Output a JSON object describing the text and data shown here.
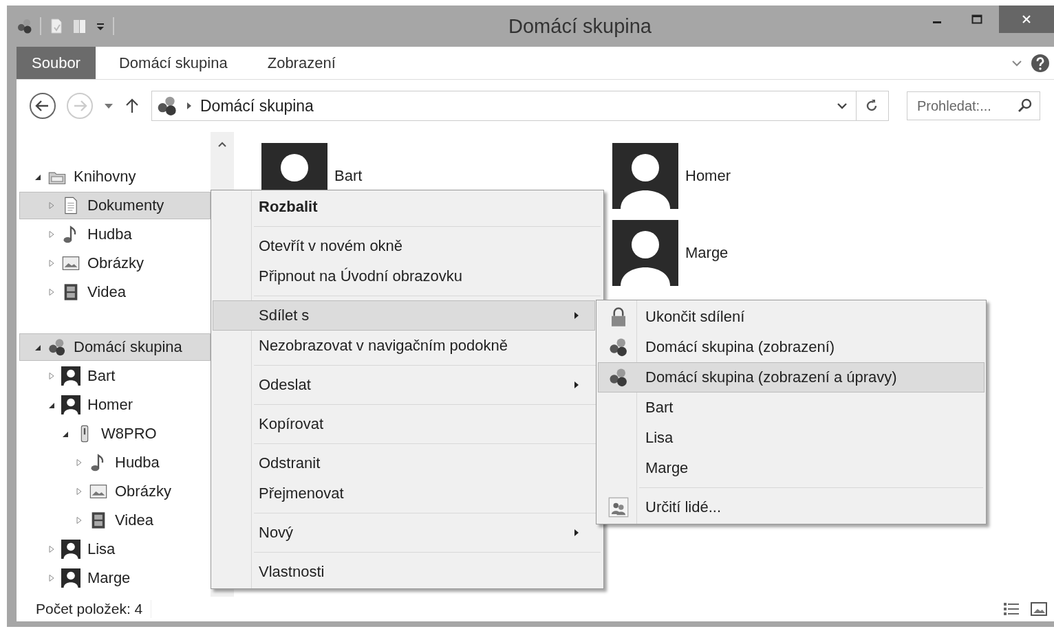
{
  "window": {
    "title": "Domácí skupina"
  },
  "ribbon": {
    "tabs": [
      {
        "label": "Soubor",
        "kind": "file",
        "selected": false
      },
      {
        "label": "Domácí skupina",
        "kind": "tab",
        "selected": false
      },
      {
        "label": "Zobrazení",
        "kind": "tab",
        "selected": false
      }
    ]
  },
  "address": {
    "path": "Domácí skupina",
    "search": {
      "placeholder": "Prohledat:..."
    }
  },
  "navigation": [
    {
      "label": "Knihovny",
      "kind": "library",
      "expanded": true,
      "selected": false,
      "children": [
        {
          "label": "Dokumenty",
          "kind": "document",
          "expanded": false,
          "selected": true
        },
        {
          "label": "Hudba",
          "kind": "music",
          "expanded": false,
          "selected": false
        },
        {
          "label": "Obrázky",
          "kind": "pictures",
          "expanded": false,
          "selected": false
        },
        {
          "label": "Videa",
          "kind": "video",
          "expanded": false,
          "selected": false
        }
      ]
    },
    {
      "label": "Domácí skupina",
      "kind": "homegroup",
      "expanded": true,
      "selected": true,
      "children": [
        {
          "label": "Bart",
          "kind": "user",
          "expanded": false,
          "selected": false
        },
        {
          "label": "Homer",
          "kind": "user",
          "expanded": true,
          "selected": false,
          "children": [
            {
              "label": "W8PRO",
              "kind": "drive",
              "expanded": true,
              "selected": false,
              "children": [
                {
                  "label": "Hudba",
                  "kind": "music",
                  "expanded": false,
                  "selected": false
                },
                {
                  "label": "Obrázky",
                  "kind": "pictures",
                  "expanded": false,
                  "selected": false
                },
                {
                  "label": "Videa",
                  "kind": "video",
                  "expanded": false,
                  "selected": false
                }
              ]
            }
          ]
        },
        {
          "label": "Lisa",
          "kind": "user",
          "expanded": false,
          "selected": false
        },
        {
          "label": "Marge",
          "kind": "user",
          "expanded": false,
          "selected": false
        }
      ]
    }
  ],
  "content": {
    "items": [
      {
        "name": "Bart"
      },
      {
        "name": "Homer"
      },
      {
        "name": "Marge"
      }
    ]
  },
  "context_menu": {
    "groups": [
      [
        {
          "label": "Rozbalit",
          "bold": true,
          "submenu": false,
          "selected": false
        }
      ],
      [
        {
          "label": "Otevřít v novém okně",
          "bold": false,
          "submenu": false,
          "selected": false
        },
        {
          "label": "Připnout na Úvodní obrazovku",
          "bold": false,
          "submenu": false,
          "selected": false
        }
      ],
      [
        {
          "label": "Sdílet s",
          "bold": false,
          "submenu": true,
          "selected": true
        },
        {
          "label": "Nezobrazovat v navigačním podokně",
          "bold": false,
          "submenu": false,
          "selected": false
        }
      ],
      [
        {
          "label": "Odeslat",
          "bold": false,
          "submenu": true,
          "selected": false
        }
      ],
      [
        {
          "label": "Kopírovat",
          "bold": false,
          "submenu": false,
          "selected": false
        }
      ],
      [
        {
          "label": "Odstranit",
          "bold": false,
          "submenu": false,
          "selected": false
        },
        {
          "label": "Přejmenovat",
          "bold": false,
          "submenu": false,
          "selected": false
        }
      ],
      [
        {
          "label": "Nový",
          "bold": false,
          "submenu": true,
          "selected": false
        }
      ],
      [
        {
          "label": "Vlastnosti",
          "bold": false,
          "submenu": false,
          "selected": false
        }
      ]
    ]
  },
  "share_submenu": {
    "groups": [
      [
        {
          "label": "Ukončit sdílení",
          "kind": "lock",
          "selected": false
        },
        {
          "label": "Domácí skupina (zobrazení)",
          "kind": "homegroup",
          "selected": false
        },
        {
          "label": "Domácí skupina (zobrazení a úpravy)",
          "kind": "homegroup",
          "selected": true
        },
        {
          "label": "Bart",
          "kind": "plain",
          "selected": false
        },
        {
          "label": "Lisa",
          "kind": "plain",
          "selected": false
        },
        {
          "label": "Marge",
          "kind": "plain",
          "selected": false
        }
      ],
      [
        {
          "label": "Určití lidé...",
          "kind": "people",
          "selected": false
        }
      ]
    ]
  },
  "status_bar": {
    "text": "Počet položek: 4"
  }
}
